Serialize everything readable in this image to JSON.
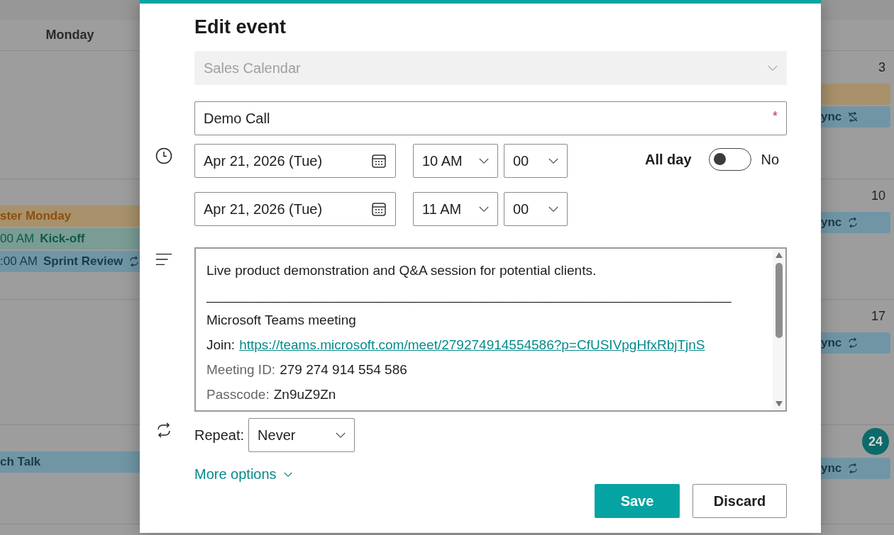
{
  "calendar": {
    "weekday_header": "Monday",
    "weeks": [
      {
        "right_day": "3",
        "today": false,
        "right_events": [
          {
            "color": "#a8916b",
            "kind": "single"
          },
          {
            "title": "ync",
            "color": "#7096a6",
            "kind": "exception"
          }
        ]
      },
      {
        "right_day": "10",
        "today": false,
        "left_events": [
          {
            "title": "ster Monday",
            "color": "#a8916b",
            "kind": "holiday"
          },
          {
            "time": "00 AM",
            "title": "Kick-off",
            "color": "#7a9c92",
            "kind": "single"
          },
          {
            "time": ":00 AM",
            "title": "Sprint Review",
            "color": "#7096a6",
            "kind": "recurring"
          }
        ],
        "right_events": [
          {
            "title": "ync",
            "color": "#7096a6",
            "kind": "recurring"
          }
        ]
      },
      {
        "right_day": "17",
        "today": false,
        "right_events": [
          {
            "title": "ync",
            "color": "#7096a6",
            "kind": "recurring"
          }
        ]
      },
      {
        "right_day": "24",
        "today": true,
        "left_events": [
          {
            "title": "ch Talk",
            "color": "#7096a6",
            "kind": "single"
          }
        ],
        "right_events": [
          {
            "title": "ync",
            "color": "#7096a6",
            "kind": "recurring"
          }
        ]
      }
    ]
  },
  "dialog": {
    "title": "Edit event",
    "calendar_select": {
      "value": "Sales Calendar",
      "disabled": true
    },
    "event_title": {
      "value": "Demo Call",
      "required_marker": "*"
    },
    "start": {
      "date": "Apr 21, 2026 (Tue)",
      "hour": "10 AM",
      "minute": "00"
    },
    "end": {
      "date": "Apr 21, 2026 (Tue)",
      "hour": "11 AM",
      "minute": "00"
    },
    "all_day": {
      "label": "All day",
      "on": false,
      "state_text": "No"
    },
    "description": [
      {
        "kind": "text",
        "text": "Live product demonstration and Q&A session for potential clients."
      },
      {
        "kind": "text",
        "text": "______________________________________________________________________"
      },
      {
        "kind": "text",
        "text": "Microsoft Teams meeting"
      },
      {
        "kind": "link",
        "label": "Join:",
        "value": "https://teams.microsoft.com/meet/279274914554586?p=CfUSIVpgHfxRbjTjnS"
      },
      {
        "kind": "field",
        "label": "Meeting ID:",
        "value": "279 274 914 554 586"
      },
      {
        "kind": "field",
        "label": "Passcode:",
        "value": "Zn9uZ9Zn"
      }
    ],
    "repeat": {
      "label": "Repeat:",
      "value": "Never"
    },
    "more_options": "More options",
    "buttons": [
      {
        "label": "Save",
        "kind": "primary"
      },
      {
        "label": "Discard",
        "kind": "secondary"
      }
    ]
  }
}
